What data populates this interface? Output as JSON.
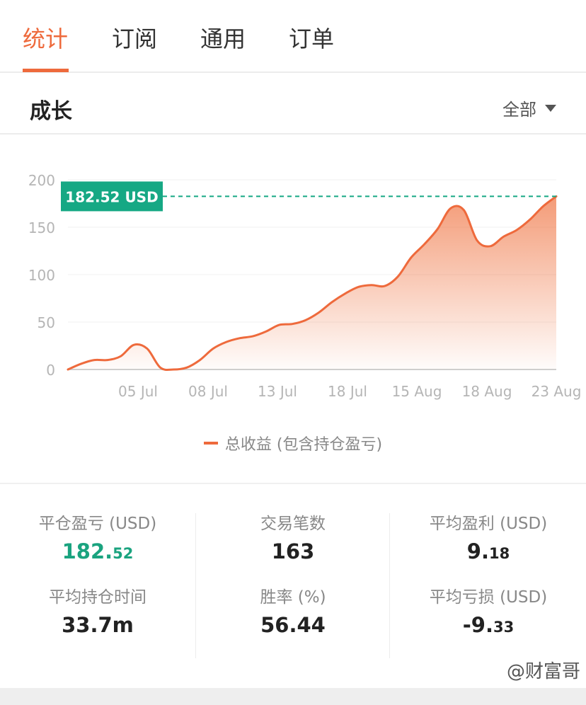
{
  "tabs": [
    {
      "label": "统计",
      "active": true
    },
    {
      "label": "订阅",
      "active": false
    },
    {
      "label": "通用",
      "active": false
    },
    {
      "label": "订单",
      "active": false
    }
  ],
  "section": {
    "title": "成长",
    "filter_label": "全部"
  },
  "colors": {
    "accent": "#ee6a3c",
    "marker": "#16a884",
    "positive": "#1aa37f"
  },
  "chart_data": {
    "type": "area",
    "title": "",
    "xlabel": "",
    "ylabel": "",
    "ylim": [
      0,
      200
    ],
    "yticks": [
      0,
      50,
      100,
      150,
      200
    ],
    "xtick_labels": [
      "05 Jul",
      "08 Jul",
      "13 Jul",
      "18 Jul",
      "15 Aug",
      "18 Aug",
      "23 Aug"
    ],
    "grid": true,
    "legend_position": "bottom",
    "current_value_label": "182.52 USD",
    "current_value": 182.52,
    "series": [
      {
        "name": "总收益 (包含持仓盈亏)",
        "values": [
          0,
          6,
          10,
          10,
          14,
          26,
          22,
          2,
          0,
          2,
          10,
          22,
          29,
          33,
          35,
          40,
          47,
          48,
          52,
          60,
          71,
          80,
          87,
          89,
          88,
          98,
          118,
          132,
          148,
          170,
          168,
          136,
          130,
          140,
          147,
          158,
          172,
          182.52
        ]
      }
    ]
  },
  "stats": [
    {
      "label": "平仓盈亏 (USD)",
      "value_int": "182.",
      "value_dec": "52",
      "positive": true
    },
    {
      "label": "交易笔数",
      "value_int": "163",
      "value_dec": "",
      "positive": false
    },
    {
      "label": "平均盈利 (USD)",
      "value_int": "9.",
      "value_dec": "18",
      "positive": false
    },
    {
      "label": "平均持仓时间",
      "value_int": "33.7m",
      "value_dec": "",
      "positive": false
    },
    {
      "label": "胜率 (%)",
      "value_int": "56.44",
      "value_dec": "",
      "positive": false
    },
    {
      "label": "平均亏损 (USD)",
      "value_int": "-9.",
      "value_dec": "33",
      "positive": false
    }
  ],
  "watermark": "@财富哥"
}
